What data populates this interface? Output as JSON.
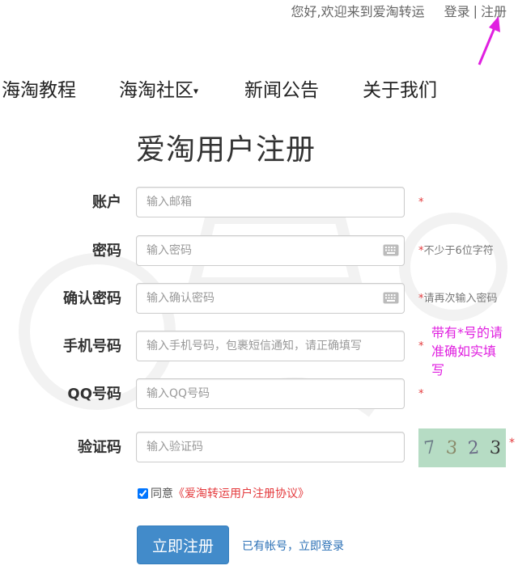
{
  "topbar": {
    "welcome": "您好,欢迎来到爱淘转运",
    "login": "登录",
    "separator": "|",
    "register": "注册"
  },
  "nav": {
    "items": [
      "海淘教程",
      "海淘社区",
      "新闻公告",
      "关于我们"
    ],
    "dropdown_caret": "▾"
  },
  "page_title": "爱淘用户注册",
  "form": {
    "account": {
      "label": "账户",
      "placeholder": "输入邮箱",
      "hint": "*"
    },
    "password": {
      "label": "密码",
      "placeholder": "输入密码",
      "hint_star": "*",
      "hint_text": "不少于6位字符"
    },
    "confirm": {
      "label": "确认密码",
      "placeholder": "输入确认密码",
      "hint_star": "*",
      "hint_text": "请再次输入密码"
    },
    "phone": {
      "label": "手机号码",
      "placeholder": "输入手机号码，包裹短信通知，请正确填写",
      "hint": "*"
    },
    "qq": {
      "label": "QQ号码",
      "placeholder": "输入QQ号码",
      "hint": "*"
    },
    "captcha": {
      "label": "验证码",
      "placeholder": "输入验证码",
      "image_digits": [
        "7",
        "3",
        "2",
        "3"
      ],
      "hint": "*"
    }
  },
  "side_note": "带有*号的请准确如实填写",
  "agree": {
    "prefix": "同意",
    "protocol": "《爱淘转运用户注册协议》",
    "checked": true
  },
  "submit_label": "立即注册",
  "login_link": "已有帐号，立即登录",
  "colors": {
    "primary": "#428bca",
    "required": "#e4393c",
    "annotation": "#e020e0",
    "captcha_bg": "#b6dcc4"
  },
  "icons": {
    "keyboard": "keyboard-icon",
    "arrow": "annotation-arrow"
  }
}
